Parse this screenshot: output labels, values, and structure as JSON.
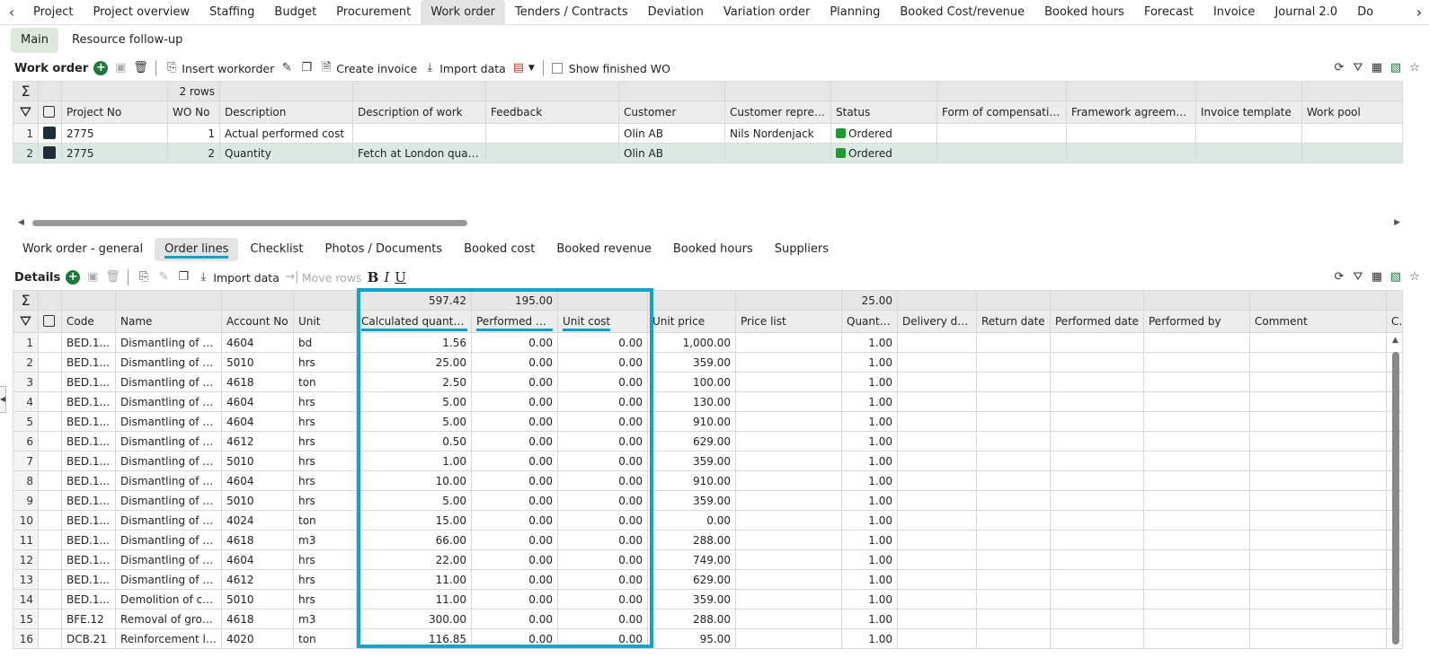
{
  "nav": {
    "tabs": [
      "Project",
      "Project overview",
      "Staffing",
      "Budget",
      "Procurement",
      "Work order",
      "Tenders / Contracts",
      "Deviation",
      "Variation order",
      "Planning",
      "Booked Cost/revenue",
      "Booked hours",
      "Forecast",
      "Invoice",
      "Journal 2.0",
      "Do"
    ],
    "active": "Work order"
  },
  "subtabs": {
    "main": "Main",
    "resource": "Resource follow-up"
  },
  "wo_toolbar": {
    "title": "Work order",
    "insert": "Insert workorder",
    "create_invoice": "Create invoice",
    "import_data": "Import data",
    "show_finished": "Show finished WO"
  },
  "wo_table": {
    "row_count": "2 rows",
    "headers": [
      "Project No",
      "WO No",
      "Description",
      "Description of work",
      "Feedback",
      "Customer",
      "Customer repres...",
      "Status",
      "Form of compensation",
      "Framework agreement",
      "Invoice template",
      "Work pool"
    ],
    "rows": [
      {
        "n": "1",
        "project": "2775",
        "wo": "1",
        "desc": "Actual performed cost",
        "work": "",
        "feedback": "",
        "customer": "Olin AB",
        "rep": "Nils Nordenjack",
        "status": "Ordered"
      },
      {
        "n": "2",
        "project": "2775",
        "wo": "2",
        "desc": "Quantity",
        "work": "Fetch at London quarry",
        "feedback": "",
        "customer": "Olin AB",
        "rep": "",
        "status": "Ordered"
      }
    ]
  },
  "detail_tabs": [
    "Work order - general",
    "Order lines",
    "Checklist",
    "Photos / Documents",
    "Booked cost",
    "Booked revenue",
    "Booked hours",
    "Suppliers"
  ],
  "detail_active": "Order lines",
  "details_toolbar": {
    "title": "Details",
    "import_data": "Import data",
    "move_rows": "Move rows",
    "bold": "B",
    "italic": "I",
    "underline": "U"
  },
  "lines": {
    "sums": {
      "calc": "597.42",
      "perf": "195.00",
      "qty": "25.00"
    },
    "headers": [
      "Code",
      "Name",
      "Account No",
      "Unit",
      "Calculated quantity",
      "Performed qty",
      "Unit cost",
      "Unit price",
      "Price list",
      "Quantity",
      "Delivery date",
      "Return date",
      "Performed date",
      "Performed by",
      "Comment",
      "C"
    ],
    "rows": [
      [
        "1",
        "BED.1...",
        "Dismantling of st...",
        "4604",
        "bd",
        "1.56",
        "0.00",
        "0.00",
        "1,000.00",
        "1.00"
      ],
      [
        "2",
        "BED.1...",
        "Dismantling of st...",
        "5010",
        "hrs",
        "25.00",
        "0.00",
        "0.00",
        "359.00",
        "1.00"
      ],
      [
        "3",
        "BED.1...",
        "Dismantling of re...",
        "4618",
        "ton",
        "2.50",
        "0.00",
        "0.00",
        "100.00",
        "1.00"
      ],
      [
        "4",
        "BED.1...",
        "Dismantling of re...",
        "4604",
        "hrs",
        "5.00",
        "0.00",
        "0.00",
        "130.00",
        "1.00"
      ],
      [
        "5",
        "BED.1...",
        "Dismantling of re...",
        "4604",
        "hrs",
        "5.00",
        "0.00",
        "0.00",
        "910.00",
        "1.00"
      ],
      [
        "6",
        "BED.1...",
        "Dismantling of re...",
        "4612",
        "hrs",
        "0.50",
        "0.00",
        "0.00",
        "629.00",
        "1.00"
      ],
      [
        "7",
        "BED.1...",
        "Dismantling of re...",
        "5010",
        "hrs",
        "1.00",
        "0.00",
        "0.00",
        "359.00",
        "1.00"
      ],
      [
        "8",
        "BED.1...",
        "Dismantling of cu...",
        "4604",
        "hrs",
        "10.00",
        "0.00",
        "0.00",
        "910.00",
        "1.00"
      ],
      [
        "9",
        "BED.1...",
        "Dismantling of cu...",
        "5010",
        "hrs",
        "5.00",
        "0.00",
        "0.00",
        "359.00",
        "1.00"
      ],
      [
        "10",
        "BED.1...",
        "Dismantling of cu...",
        "4024",
        "ton",
        "15.00",
        "0.00",
        "0.00",
        "0.00",
        "1.00"
      ],
      [
        "11",
        "BED.1...",
        "Dismantling of co...",
        "4618",
        "m3",
        "66.00",
        "0.00",
        "0.00",
        "288.00",
        "1.00"
      ],
      [
        "12",
        "BED.1...",
        "Dismantling of co...",
        "4604",
        "hrs",
        "22.00",
        "0.00",
        "0.00",
        "749.00",
        "1.00"
      ],
      [
        "13",
        "BED.1...",
        "Dismantling of co...",
        "4612",
        "hrs",
        "11.00",
        "0.00",
        "0.00",
        "629.00",
        "1.00"
      ],
      [
        "14",
        "BED.1...",
        "Demolition of con...",
        "5010",
        "hrs",
        "11.00",
        "0.00",
        "0.00",
        "359.00",
        "1.00"
      ],
      [
        "15",
        "BFE.12",
        "Removal of groun...",
        "4618",
        "m3",
        "300.00",
        "0.00",
        "0.00",
        "288.00",
        "1.00"
      ],
      [
        "16",
        "DCB.21",
        "Reinforcement la...",
        "4020",
        "ton",
        "116.85",
        "0.00",
        "0.00",
        "95.00",
        "1.00"
      ]
    ]
  },
  "colors": {
    "highlight": "#13a3c9",
    "status_green": "#1f9a34",
    "add_green": "#1b7a3a"
  }
}
